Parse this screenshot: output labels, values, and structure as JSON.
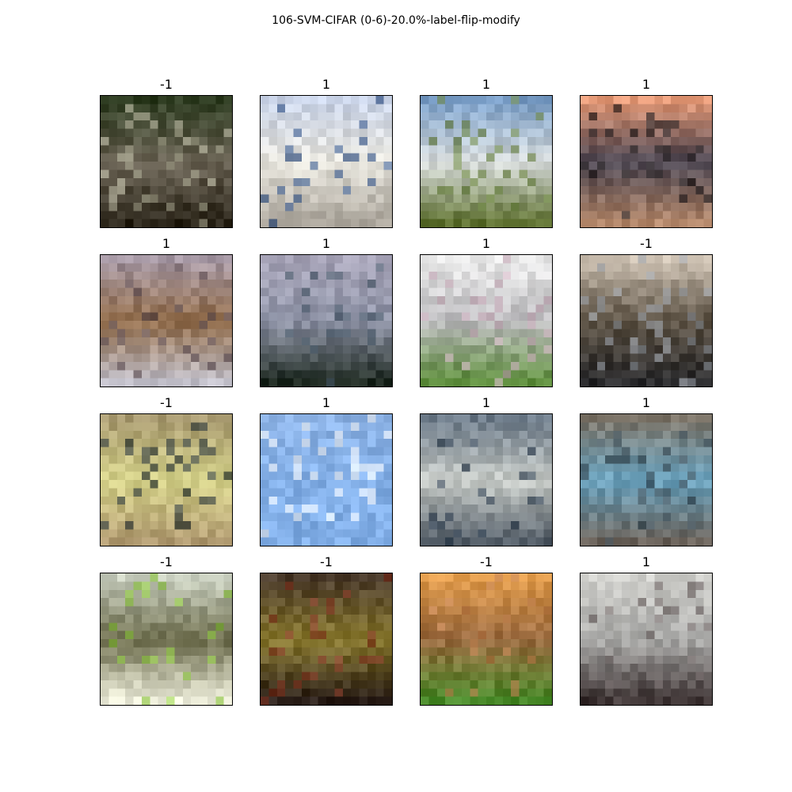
{
  "figure": {
    "title": "106-SVM-CIFAR (0-6)-20.0%-label-flip-modify"
  },
  "panels": [
    {
      "label": "-1",
      "colors": {
        "top": "#2f3d22",
        "mid": "#6b6455",
        "bottom": "#2a2418",
        "accent": "#b8b6a0"
      }
    },
    {
      "label": "1",
      "colors": {
        "top": "#c8d2e6",
        "mid": "#e6e4dc",
        "bottom": "#a8a298",
        "accent": "#2d4f86"
      }
    },
    {
      "label": "1",
      "colors": {
        "top": "#7a9ec7",
        "mid": "#d8dcdc",
        "bottom": "#5e7030",
        "accent": "#627b37"
      }
    },
    {
      "label": "1",
      "colors": {
        "top": "#e59a78",
        "mid": "#4a4450",
        "bottom": "#b3876a",
        "accent": "#1e1a1c"
      }
    },
    {
      "label": "1",
      "colors": {
        "top": "#a89aa6",
        "mid": "#8f6a48",
        "bottom": "#c3c1cb",
        "accent": "#5a4a50"
      }
    },
    {
      "label": "1",
      "colors": {
        "top": "#a7a4b8",
        "mid": "#8f94a7",
        "bottom": "#1f2a22",
        "accent": "#455666"
      }
    },
    {
      "label": "1",
      "colors": {
        "top": "#ebebeb",
        "mid": "#bdbcbf",
        "bottom": "#5b8a3a",
        "accent": "#c7a9b8"
      }
    },
    {
      "label": "-1",
      "colors": {
        "top": "#cdc1b2",
        "mid": "#5e5446",
        "bottom": "#2a2a2c",
        "accent": "#9aa0a8"
      }
    },
    {
      "label": "-1",
      "colors": {
        "top": "#a89a70",
        "mid": "#d5d28a",
        "bottom": "#b09a70",
        "accent": "#1e2a30"
      }
    },
    {
      "label": "1",
      "colors": {
        "top": "#8db3e6",
        "mid": "#84b0e8",
        "bottom": "#80ade6",
        "accent": "#ffffff"
      }
    },
    {
      "label": "1",
      "colors": {
        "top": "#6c7a88",
        "mid": "#c8ccc8",
        "bottom": "#525c66",
        "accent": "#2a3a4c"
      }
    },
    {
      "label": "1",
      "colors": {
        "top": "#7c7468",
        "mid": "#6ca4c0",
        "bottom": "#6a625a",
        "accent": "#3a4a54"
      }
    },
    {
      "label": "-1",
      "colors": {
        "top": "#cad0c0",
        "mid": "#6a6a4a",
        "bottom": "#efefdc",
        "accent": "#8cc83c"
      }
    },
    {
      "label": "-1",
      "colors": {
        "top": "#4a3a2a",
        "mid": "#8a7a30",
        "bottom": "#2a1e18",
        "accent": "#8a3a28"
      }
    },
    {
      "label": "-1",
      "colors": {
        "top": "#e09a4a",
        "mid": "#9a6a40",
        "bottom": "#4a8a2a",
        "accent": "#c08050"
      }
    },
    {
      "label": "1",
      "colors": {
        "top": "#cfcfcb",
        "mid": "#aaaaa8",
        "bottom": "#3a3030",
        "accent": "#6a6060"
      }
    }
  ]
}
